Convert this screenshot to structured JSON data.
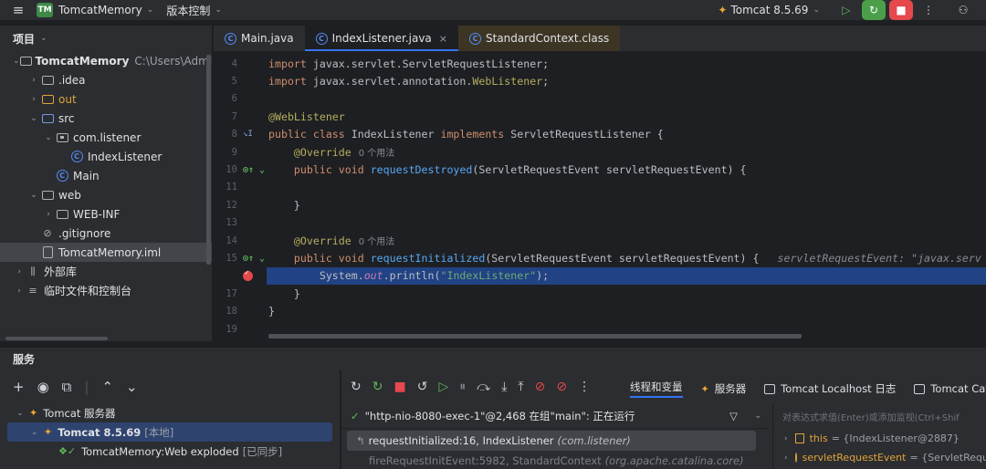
{
  "titlebar": {
    "project_badge": "TM",
    "project_name": "TomcatMemory",
    "vcs_label": "版本控制",
    "run_config": "Tomcat 8.5.69"
  },
  "project_panel": {
    "title": "项目",
    "tree": [
      {
        "level": 0,
        "toggle": "⌄",
        "icon": "folder-icon",
        "label": "TomcatMemory",
        "extra": "C:\\Users\\Administ",
        "bold": true
      },
      {
        "level": 1,
        "toggle": "›",
        "icon": "folder-icon",
        "label": ".idea"
      },
      {
        "level": 1,
        "toggle": "›",
        "icon": "folder-orange-icon",
        "label": "out",
        "orange": true
      },
      {
        "level": 1,
        "toggle": "⌄",
        "icon": "folder-blue-icon",
        "label": "src"
      },
      {
        "level": 2,
        "toggle": "⌄",
        "icon": "package-icon",
        "label": "com.listener"
      },
      {
        "level": 3,
        "toggle": "",
        "icon": "class-icon",
        "label": "IndexListener"
      },
      {
        "level": 2,
        "toggle": "",
        "icon": "class-icon",
        "label": "Main"
      },
      {
        "level": 1,
        "toggle": "⌄",
        "icon": "folder-icon",
        "label": "web"
      },
      {
        "level": 2,
        "toggle": "›",
        "icon": "folder-icon",
        "label": "WEB-INF"
      },
      {
        "level": 1,
        "toggle": "",
        "icon": "gitignore-icon",
        "label": ".gitignore"
      },
      {
        "level": 1,
        "toggle": "",
        "icon": "file-icon",
        "label": "TomcatMemory.iml",
        "selected": true
      },
      {
        "level": 0,
        "toggle": "›",
        "icon": "library-icon",
        "label": "外部库"
      },
      {
        "level": 0,
        "toggle": "›",
        "icon": "scratches-icon",
        "label": "临时文件和控制台"
      }
    ]
  },
  "tabs": [
    {
      "label": "Main.java",
      "active": false
    },
    {
      "label": "IndexListener.java",
      "active": true,
      "close": "×"
    },
    {
      "label": "StandardContext.class",
      "active": false
    }
  ],
  "editor": {
    "lines": [
      {
        "n": "4",
        "html": "<span class='kw'>import</span> javax.servlet.ServletRequestListener;"
      },
      {
        "n": "5",
        "html": "<span class='kw'>import</span> javax.servlet.annotation.<span class='ann'>WebListener</span>;"
      },
      {
        "n": "6",
        "html": ""
      },
      {
        "n": "7",
        "html": "<span class='ann'>@WebListener</span>"
      },
      {
        "n": "8",
        "html": "<span class='kw'>public class</span> IndexListener <span class='kw'>implements</span> ServletRequestListener {",
        "gutter": "impl"
      },
      {
        "n": "9",
        "html": "    <span class='ann'>@Override</span>",
        "hint": "0 个用法"
      },
      {
        "n": "10",
        "html": "    <span class='kw'>public void</span> <span class='fn'>requestDestroyed</span>(ServletRequestEvent servletRequestEvent) {",
        "gutter": "override"
      },
      {
        "n": "11",
        "html": ""
      },
      {
        "n": "12",
        "html": "    }"
      },
      {
        "n": "13",
        "html": ""
      },
      {
        "n": "14",
        "html": "    <span class='ann'>@Override</span>",
        "hint": "0 个用法"
      },
      {
        "n": "15",
        "html": "    <span class='kw'>public void</span> <span class='fn'>requestInitialized</span>(ServletRequestEvent servletRequestEvent) {",
        "gutter": "override",
        "inline": "servletRequestEvent: \"javax.serv"
      },
      {
        "n": "",
        "html": "        System.<span class='fld'>out</span>.println(<span class='str'>\"IndexListener\"</span>);",
        "gutter": "breakpoint",
        "highlight": true
      },
      {
        "n": "17",
        "html": "    }"
      },
      {
        "n": "18",
        "html": "}"
      },
      {
        "n": "19",
        "html": ""
      }
    ]
  },
  "services": {
    "title": "服务",
    "tree": [
      {
        "label": "Tomcat 服务器",
        "toggle": "⌄",
        "indent": 0
      },
      {
        "label": "Tomcat 8.5.69",
        "suffix": "[本地]",
        "toggle": "⌄",
        "indent": 1,
        "selected": true,
        "bold": true
      },
      {
        "label": "TomcatMemory:Web exploded",
        "suffix": "[已同步]",
        "toggle": "",
        "indent": 2
      }
    ]
  },
  "debugger": {
    "tabs": [
      "线程和变量",
      "服务器",
      "Tomcat Localhost 日志",
      "Tomcat Cat"
    ],
    "thread": "\"http-nio-8080-exec-1\"@2,468 在组\"main\": 正在运行",
    "frames": [
      {
        "method": "requestInitialized:16, IndexListener",
        "pkg": "(com.listener)",
        "selected": true
      },
      {
        "method": "fireRequestInitEvent:5982, StandardContext",
        "pkg": "(org.apache.catalina.core)",
        "selected": false
      }
    ],
    "vars_hint": "对表达式求值(Enter)或添加监视(Ctrl+Shif",
    "vars": [
      {
        "name": "this",
        "value": "= {IndexListener@2887}",
        "kind": "field"
      },
      {
        "name": "servletRequestEvent",
        "value": "= {ServletReque",
        "kind": "param"
      }
    ]
  }
}
